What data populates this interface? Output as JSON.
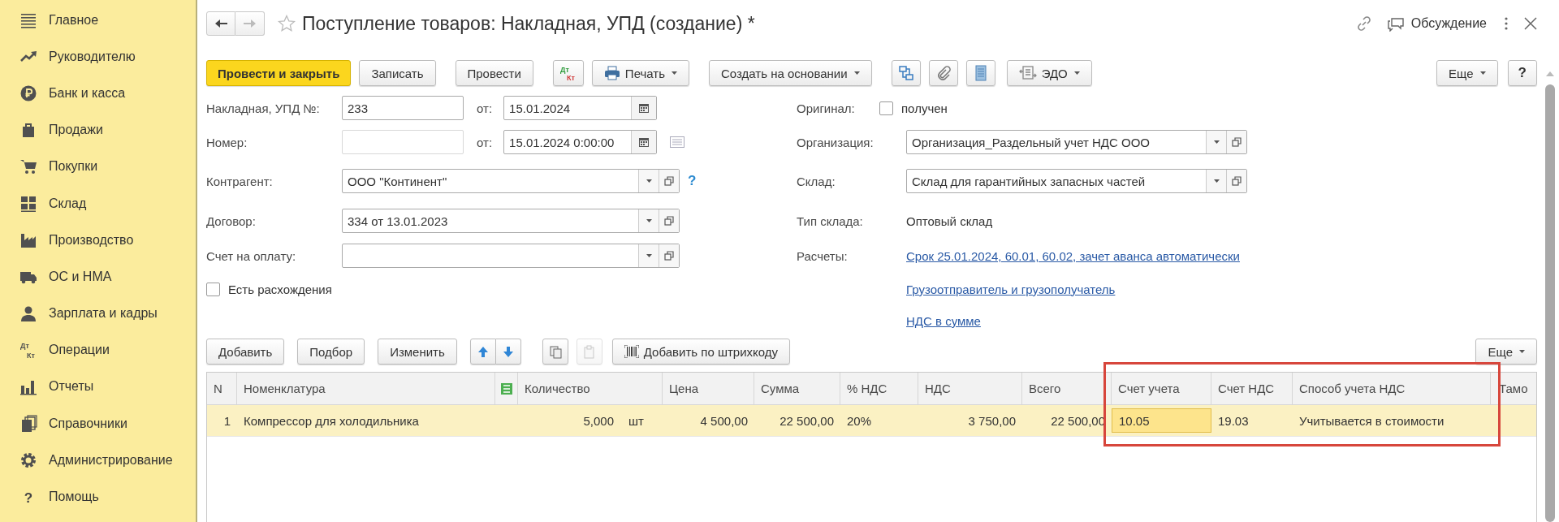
{
  "sidebar": {
    "items": [
      {
        "label": "Главное"
      },
      {
        "label": "Руководителю"
      },
      {
        "label": "Банк и касса"
      },
      {
        "label": "Продажи"
      },
      {
        "label": "Покупки"
      },
      {
        "label": "Склад"
      },
      {
        "label": "Производство"
      },
      {
        "label": "ОС и НМА"
      },
      {
        "label": "Зарплата и кадры"
      },
      {
        "label": "Операции",
        "icon_text": [
          "Дт",
          "Кт"
        ]
      },
      {
        "label": "Отчеты"
      },
      {
        "label": "Справочники"
      },
      {
        "label": "Администрирование"
      },
      {
        "label": "Помощь",
        "icon_text": [
          "?"
        ]
      }
    ]
  },
  "nav": {
    "back": {
      "disabled": false
    },
    "forward": {
      "disabled": true
    }
  },
  "window": {
    "title": "Поступление товаров: Накладная, УПД (создание) *",
    "discussion": "Обсуждение"
  },
  "toolbar": {
    "buttons": [
      {
        "kind": "primary",
        "label": "Провести и закрыть"
      },
      {
        "kind": "plain",
        "label": "Записать"
      },
      {
        "kind": "plain",
        "label": "Провести"
      },
      {
        "kind": "icon",
        "icon_text": [
          "Дт",
          "Кт"
        ]
      },
      {
        "kind": "menu",
        "label": "Печать"
      },
      {
        "kind": "menu",
        "label": "Создать на основании"
      },
      {
        "kind": "icon"
      },
      {
        "kind": "icon"
      },
      {
        "kind": "icon"
      },
      {
        "kind": "menu",
        "label": "ЭДО"
      }
    ],
    "more": "Еще",
    "help": "?"
  },
  "form": {
    "left": [
      {
        "kind": "number_date",
        "label": "Накладная, УПД №:",
        "value": "233",
        "disabled": false,
        "date_label": "от:",
        "date": "15.01.2024"
      },
      {
        "kind": "number_date",
        "label": "Номер:",
        "disabled": true,
        "date_label": "от:",
        "date": "15.01.2024  0:00:00"
      },
      {
        "kind": "select",
        "label": "Контрагент:",
        "value": "ООО \"Континент\"",
        "help": "?"
      },
      {
        "kind": "select",
        "label": "Договор:",
        "value": "334 от 13.01.2023"
      },
      {
        "kind": "select",
        "label": "Счет на оплату:"
      },
      {
        "kind": "checkbox",
        "option": "Есть расхождения",
        "checked": false
      }
    ],
    "right": [
      {
        "kind": "checkbox",
        "label": "Оригинал:",
        "option": "получен",
        "checked": false
      },
      {
        "kind": "select",
        "label": "Организация:",
        "value": "Организация_Раздельный учет НДС ООО"
      },
      {
        "kind": "select",
        "label": "Склад:",
        "value": "Склад для гарантийных запасных частей"
      },
      {
        "kind": "text",
        "label": "Тип склада:",
        "value": "Оптовый склад"
      },
      {
        "kind": "link",
        "label": "Расчеты:",
        "value": "Срок 25.01.2024, 60.01, 60.02, зачет аванса автоматически"
      },
      {
        "kind": "link",
        "value": "Грузоотправитель и грузополучатель"
      },
      {
        "kind": "link",
        "value": "НДС в сумме"
      }
    ]
  },
  "table_toolbar": {
    "buttons": [
      {
        "kind": "plain",
        "label": "Добавить",
        "disabled": false
      },
      {
        "kind": "plain",
        "label": "Подбор",
        "disabled": false
      },
      {
        "kind": "plain",
        "label": "Изменить",
        "disabled": false
      },
      {
        "kind": "icon",
        "disabled": false
      },
      {
        "kind": "icon",
        "disabled": false
      },
      {
        "kind": "icon",
        "disabled": false
      },
      {
        "kind": "icon",
        "disabled": true
      },
      {
        "kind": "plain",
        "label": "Добавить по штрихкоду",
        "disabled": false
      }
    ],
    "more": "Еще"
  },
  "table": {
    "columns": [
      {
        "kind": "text",
        "label": "N",
        "highlighted": false,
        "focused": false
      },
      {
        "kind": "text",
        "label": "Номенклатура",
        "highlighted": false,
        "focused": false
      },
      {
        "kind": "icon",
        "highlighted": false,
        "focused": false
      },
      {
        "kind": "quantity",
        "label": "Количество",
        "highlighted": false,
        "focused": false
      },
      {
        "kind": "number",
        "label": "Цена",
        "highlighted": false,
        "focused": false
      },
      {
        "kind": "number",
        "label": "Сумма",
        "highlighted": false,
        "focused": false
      },
      {
        "kind": "text",
        "label": "% НДС",
        "highlighted": false,
        "focused": false
      },
      {
        "kind": "number",
        "label": "НДС",
        "highlighted": false,
        "focused": false
      },
      {
        "kind": "number",
        "label": "Всего",
        "highlighted": false,
        "focused": false
      },
      {
        "kind": "text",
        "label": "Счет учета",
        "highlighted": true,
        "focused": true
      },
      {
        "kind": "text",
        "label": "Счет НДС",
        "highlighted": true,
        "focused": false
      },
      {
        "kind": "text",
        "label": "Способ учета НДС",
        "highlighted": true,
        "focused": false
      },
      {
        "kind": "text",
        "label": "Тамо",
        "highlighted": false,
        "focused": false
      }
    ],
    "rows": [
      {
        "selected": true,
        "unit": "шт",
        "cells": [
          "1",
          "Компрессор для холодильника",
          null,
          "5,000",
          "4 500,00",
          "22 500,00",
          "20%",
          "3 750,00",
          "22 500,00",
          "10.05",
          "19.03",
          "Учитывается в стоимости",
          null
        ]
      }
    ]
  }
}
